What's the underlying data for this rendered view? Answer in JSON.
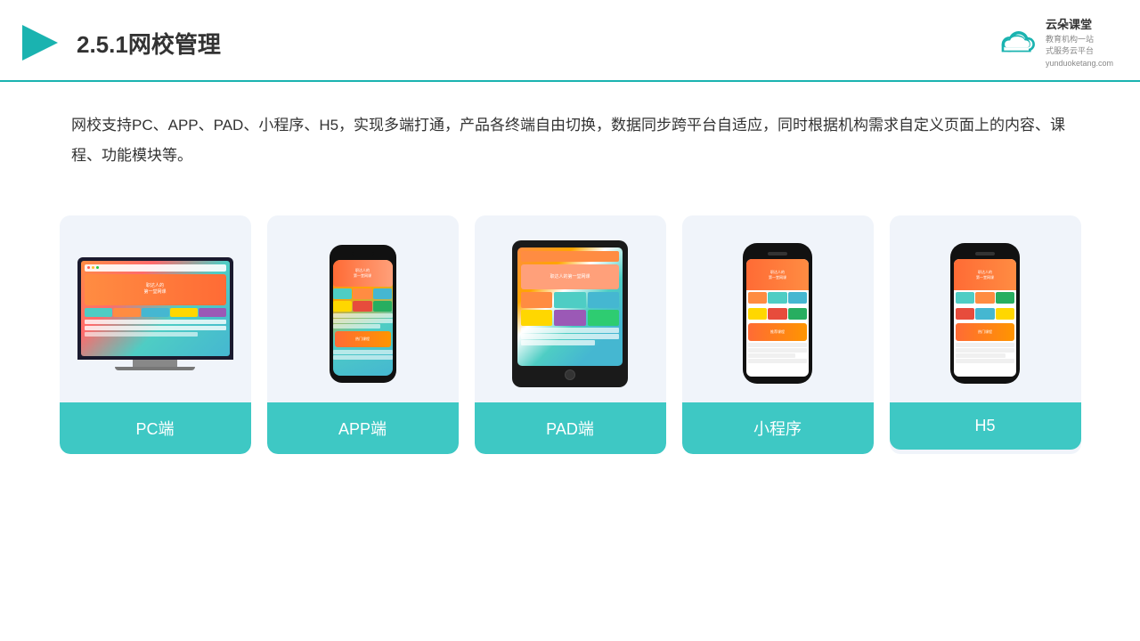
{
  "header": {
    "title": "2.5.1网校管理",
    "brand": {
      "name": "云朵课堂",
      "tagline1": "教育机构一站",
      "tagline2": "式服务云平台",
      "url": "yunduoketang.com"
    }
  },
  "description": "网校支持PC、APP、PAD、小程序、H5，实现多端打通，产品各终端自由切换，数据同步跨平台自适应，同时根据机构需求自定义页面上的内容、课程、功能模块等。",
  "cards": [
    {
      "id": "pc",
      "label": "PC端"
    },
    {
      "id": "app",
      "label": "APP端"
    },
    {
      "id": "pad",
      "label": "PAD端"
    },
    {
      "id": "miniprogram",
      "label": "小程序"
    },
    {
      "id": "h5",
      "label": "H5"
    }
  ]
}
